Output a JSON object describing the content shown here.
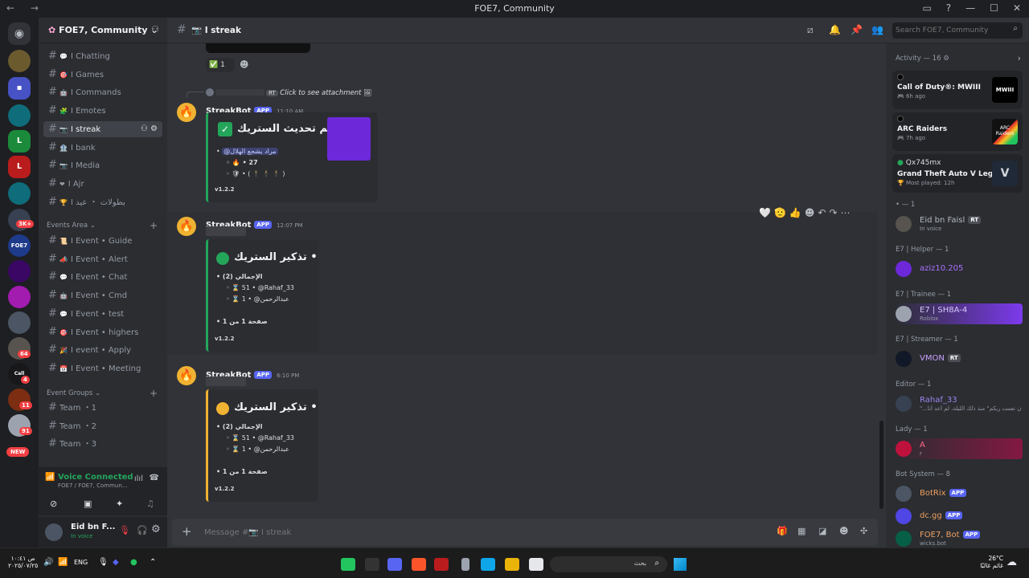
{
  "window": {
    "title": "FOE7, Community"
  },
  "server": {
    "name": "FOE7, Community"
  },
  "channels": [
    {
      "emoji": "💬",
      "name": "I Chatting"
    },
    {
      "emoji": "🎯",
      "name": "I Games"
    },
    {
      "emoji": "🤖",
      "name": "I Commands"
    },
    {
      "emoji": "🧩",
      "name": "I Emotes"
    },
    {
      "emoji": "📷",
      "name": "I streak"
    },
    {
      "emoji": "🏦",
      "name": "I bank"
    },
    {
      "emoji": "📷",
      "name": "I Media"
    },
    {
      "emoji": "❤",
      "name": "I Ajr"
    },
    {
      "emoji": "🏆",
      "name": "I بطولات ・ عيد"
    }
  ],
  "categories": {
    "events": "Events Area",
    "groups": "Event Groups"
  },
  "event_channels": [
    {
      "emoji": "📜",
      "name": "I Event • Guide"
    },
    {
      "emoji": "📣",
      "name": "I Event • Alert"
    },
    {
      "emoji": "💬",
      "name": "I Event • Chat"
    },
    {
      "emoji": "🤖",
      "name": "I Event • Cmd"
    },
    {
      "emoji": "💬",
      "name": "I Event • test"
    },
    {
      "emoji": "🎯",
      "name": "I Event • highers"
    },
    {
      "emoji": "🎉",
      "name": "I event • Apply"
    },
    {
      "emoji": "📅",
      "name": "I Event • Meeting"
    }
  ],
  "group_channels": [
    {
      "name": "Team ・1"
    },
    {
      "name": "Team ・2"
    },
    {
      "name": "Team ・3"
    }
  ],
  "server_badges": [
    "3K+",
    "64",
    "4",
    "11",
    "91"
  ],
  "new_badge": "NEW",
  "voice": {
    "status": "Voice Connected",
    "location": "FOE7 / FOE7, Commun..."
  },
  "user": {
    "name": "Eid bn F...",
    "status": "In voice"
  },
  "header": {
    "channel": "I streak",
    "search_placeholder": "Search FOE7, Community"
  },
  "reply_preview": {
    "tag": "RT",
    "text": "Click to see attachment"
  },
  "reaction": {
    "count": "1"
  },
  "messages": [
    {
      "author": "StreakBot",
      "tag": "APP",
      "time": "11:10 AM",
      "title": "تم تحديث الستريك •",
      "lines": [
        "@مراد يشجع الهلال",
        "🔥 • 27",
        "🛡 • ( 🕴 🕴 🕴 )"
      ],
      "version": "v1.2.2"
    },
    {
      "author": "StreakBot",
      "tag": "APP",
      "time": "12:07 PM",
      "title": "تذكير الستريك •",
      "lines": [
        "الإجمالي (2)",
        "⌛ 51 • @Rahaf_33",
        "⌛ 1 • @عبدالرحمن",
        "صفحة 1 من 1"
      ],
      "version": "v1.2.2"
    },
    {
      "author": "StreakBot",
      "tag": "APP",
      "time": "6:10 PM",
      "title": "تذكير الستريك •",
      "lines": [
        "الإجمالي (2)",
        "⌛ 51 • @Rahaf_33",
        "⌛ 1 • @عبدالرحمن",
        "صفحة 1 من 1"
      ],
      "version": "v1.2.2"
    }
  ],
  "composer": {
    "placeholder": "Message #📷 I streak"
  },
  "activity": {
    "header": "Activity — 16",
    "items": [
      {
        "game": "Call of Duty®: MWIII",
        "sub": "6h ago",
        "thumb": "MWIII"
      },
      {
        "game": "ARC Raiders",
        "sub": "7h ago",
        "thumb": "ARC Raiders"
      },
      {
        "user": "Qx745mx",
        "game": "Grand Theft Auto V Legacy",
        "sub": "Most played: 12h",
        "thumb": "V"
      }
    ]
  },
  "member_sections": [
    {
      "title": "• — 1",
      "members": [
        {
          "name": "Eid bn Faisl",
          "sub": "In voice",
          "tag": "RT",
          "color": "#b5bac1"
        }
      ]
    },
    {
      "title": "E7 | Helper — 1",
      "members": [
        {
          "name": "aziz10.205",
          "sub": "",
          "color": "#a970ff"
        }
      ]
    },
    {
      "title": "E7 | Trainee — 1",
      "members": [
        {
          "name": "E7 | SH8A-4",
          "sub": "Roblox",
          "color": "#d7c8ff"
        }
      ]
    },
    {
      "title": "E7 | Streamer — 1",
      "members": [
        {
          "name": "VMON",
          "sub": "",
          "tag": "RT",
          "color": "#c9a2ff"
        }
      ]
    },
    {
      "title": "Editor — 1",
      "members": [
        {
          "name": "Rahaf_33",
          "sub": "\"...الله مدد أن نعمت ربكم\" منذ ذلك الليلة، لم أعد أنا\"",
          "color": "#9b84ec"
        }
      ]
    },
    {
      "title": "Lady — 1",
      "members": [
        {
          "name": "A",
          "sub": "r",
          "color": "#ff6b8b"
        }
      ]
    },
    {
      "title": "Bot System — 8",
      "members": [
        {
          "name": "BotRix",
          "sub": "",
          "tag": "APP",
          "color": "#f0a060"
        },
        {
          "name": "dc.gg",
          "sub": "",
          "tag": "APP",
          "color": "#f0a060"
        },
        {
          "name": "FOE7, Bot",
          "sub": "wicks.bot",
          "tag": "APP",
          "color": "#f0a060"
        }
      ]
    }
  ],
  "taskbar": {
    "language": "ENG",
    "time": "ص ١٠:٤١",
    "date": "٢٠٢٥/٠٧/٢٥",
    "weather_temp": "26°C",
    "weather_desc": "غائم غالبًا",
    "search_placeholder": "بحث"
  },
  "colors": {
    "accent": "#5865f2",
    "online": "#23a55a",
    "embed_yellow": "#f0b232"
  }
}
